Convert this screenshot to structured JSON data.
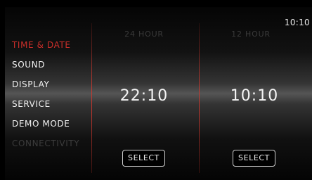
{
  "status": {
    "clock": "10:10"
  },
  "menu": {
    "items": [
      {
        "label": "TIME & DATE",
        "state": "active"
      },
      {
        "label": "SOUND",
        "state": "normal"
      },
      {
        "label": "DISPLAY",
        "state": "normal"
      },
      {
        "label": "SERVICE",
        "state": "normal"
      },
      {
        "label": "DEMO MODE",
        "state": "normal"
      },
      {
        "label": "CONNECTIVITY",
        "state": "disabled"
      }
    ]
  },
  "options": [
    {
      "heading": "24 HOUR",
      "time": "22:10",
      "button_label": "SELECT"
    },
    {
      "heading": "12 HOUR",
      "time": "10:10",
      "button_label": "SELECT"
    }
  ],
  "colors": {
    "accent": "#cc2f2a",
    "text": "#f2f2f2",
    "disabled": "#3c3c3c",
    "background": "#000000"
  }
}
